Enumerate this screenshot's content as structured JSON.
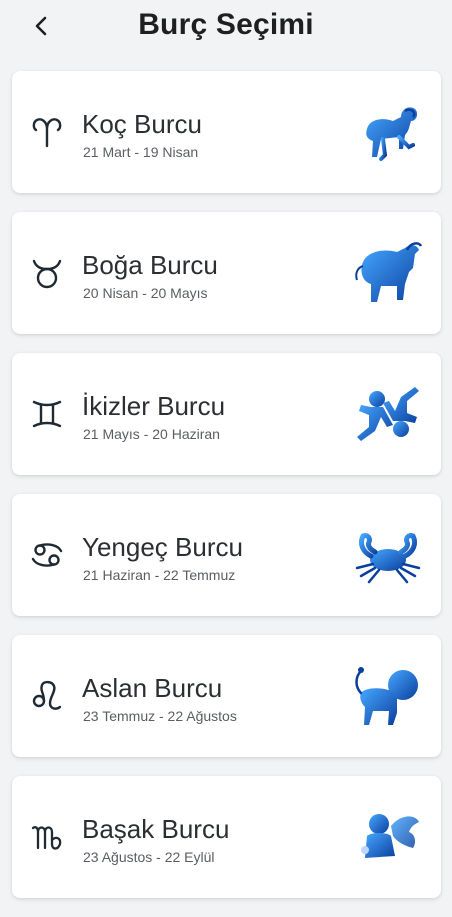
{
  "header": {
    "title": "Burç Seçimi"
  },
  "signs": [
    {
      "name": "Koç Burcu",
      "dates": "21 Mart - 19 Nisan",
      "symbol": "aries-symbol",
      "art": "ram"
    },
    {
      "name": "Boğa Burcu",
      "dates": "20 Nisan - 20 Mayıs",
      "symbol": "taurus-symbol",
      "art": "bull"
    },
    {
      "name": "İkizler Burcu",
      "dates": "21 Mayıs - 20 Haziran",
      "symbol": "gemini-symbol",
      "art": "twins"
    },
    {
      "name": "Yengeç Burcu",
      "dates": "21 Haziran - 22 Temmuz",
      "symbol": "cancer-symbol",
      "art": "crab"
    },
    {
      "name": "Aslan Burcu",
      "dates": "23 Temmuz - 22 Ağustos",
      "symbol": "leo-symbol",
      "art": "lion"
    },
    {
      "name": "Başak Burcu",
      "dates": "23 Ağustos - 22 Eylül",
      "symbol": "virgo-symbol",
      "art": "maiden"
    }
  ],
  "colors": {
    "accent": "#1e63c6",
    "symbol": "#1f2a33",
    "background": "#f2f3f5"
  }
}
